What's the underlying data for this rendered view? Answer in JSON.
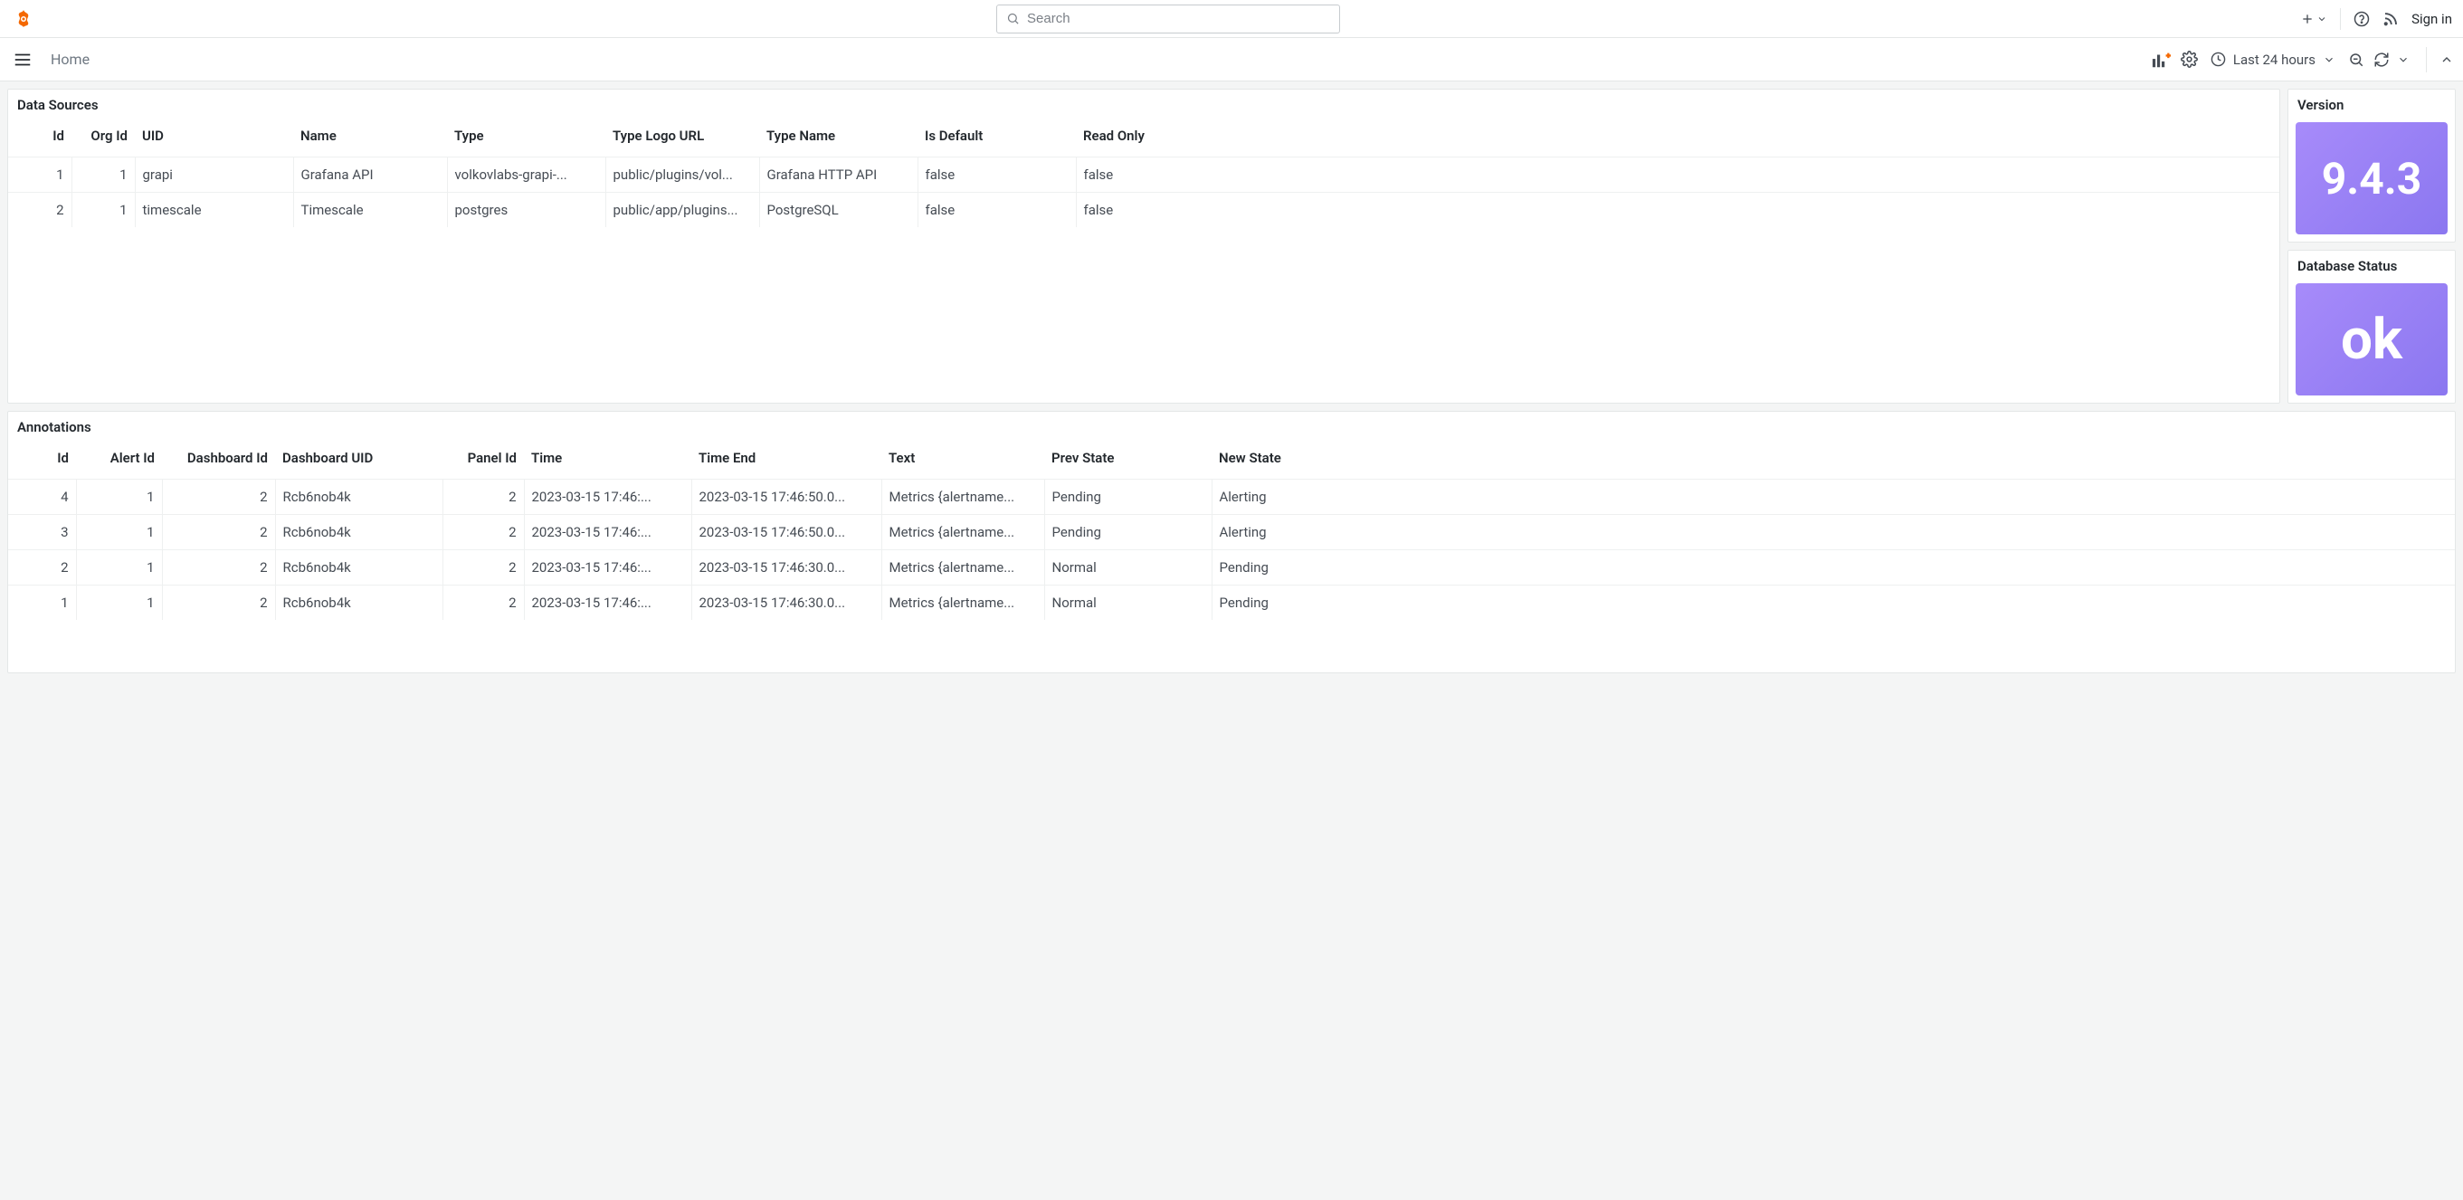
{
  "header": {
    "search_placeholder": "Search",
    "signin": "Sign in"
  },
  "toolbar": {
    "breadcrumb": "Home",
    "timerange": "Last 24 hours"
  },
  "panels": {
    "datasources": {
      "title": "Data Sources",
      "columns": [
        "Id",
        "Org Id",
        "UID",
        "Name",
        "Type",
        "Type Logo URL",
        "Type Name",
        "Is Default",
        "Read Only"
      ],
      "rows": [
        {
          "id": "1",
          "orgid": "1",
          "uid": "grapi",
          "name": "Grafana API",
          "type": "volkovlabs-grapi-...",
          "logo": "public/plugins/vol...",
          "typename": "Grafana HTTP API",
          "isdefault": "false",
          "readonly": "false"
        },
        {
          "id": "2",
          "orgid": "1",
          "uid": "timescale",
          "name": "Timescale",
          "type": "postgres",
          "logo": "public/app/plugins...",
          "typename": "PostgreSQL",
          "isdefault": "false",
          "readonly": "false"
        }
      ]
    },
    "version": {
      "title": "Version",
      "value": "9.4.3"
    },
    "dbstatus": {
      "title": "Database Status",
      "value": "ok"
    },
    "annotations": {
      "title": "Annotations",
      "columns": [
        "Id",
        "Alert Id",
        "Dashboard Id",
        "Dashboard UID",
        "Panel Id",
        "Time",
        "Time End",
        "Text",
        "Prev State",
        "New State"
      ],
      "rows": [
        {
          "id": "4",
          "alertid": "1",
          "dashid": "2",
          "dashuid": "Rcb6nob4k",
          "panelid": "2",
          "time": "2023-03-15 17:46:...",
          "timeend": "2023-03-15 17:46:50.0...",
          "text": "Metrics {alertname...",
          "prev": "Pending",
          "new": "Alerting"
        },
        {
          "id": "3",
          "alertid": "1",
          "dashid": "2",
          "dashuid": "Rcb6nob4k",
          "panelid": "2",
          "time": "2023-03-15 17:46:...",
          "timeend": "2023-03-15 17:46:50.0...",
          "text": "Metrics {alertname...",
          "prev": "Pending",
          "new": "Alerting"
        },
        {
          "id": "2",
          "alertid": "1",
          "dashid": "2",
          "dashuid": "Rcb6nob4k",
          "panelid": "2",
          "time": "2023-03-15 17:46:...",
          "timeend": "2023-03-15 17:46:30.0...",
          "text": "Metrics {alertname...",
          "prev": "Normal",
          "new": "Pending"
        },
        {
          "id": "1",
          "alertid": "1",
          "dashid": "2",
          "dashuid": "Rcb6nob4k",
          "panelid": "2",
          "time": "2023-03-15 17:46:...",
          "timeend": "2023-03-15 17:46:30.0...",
          "text": "Metrics {alertname...",
          "prev": "Normal",
          "new": "Pending"
        }
      ]
    }
  }
}
